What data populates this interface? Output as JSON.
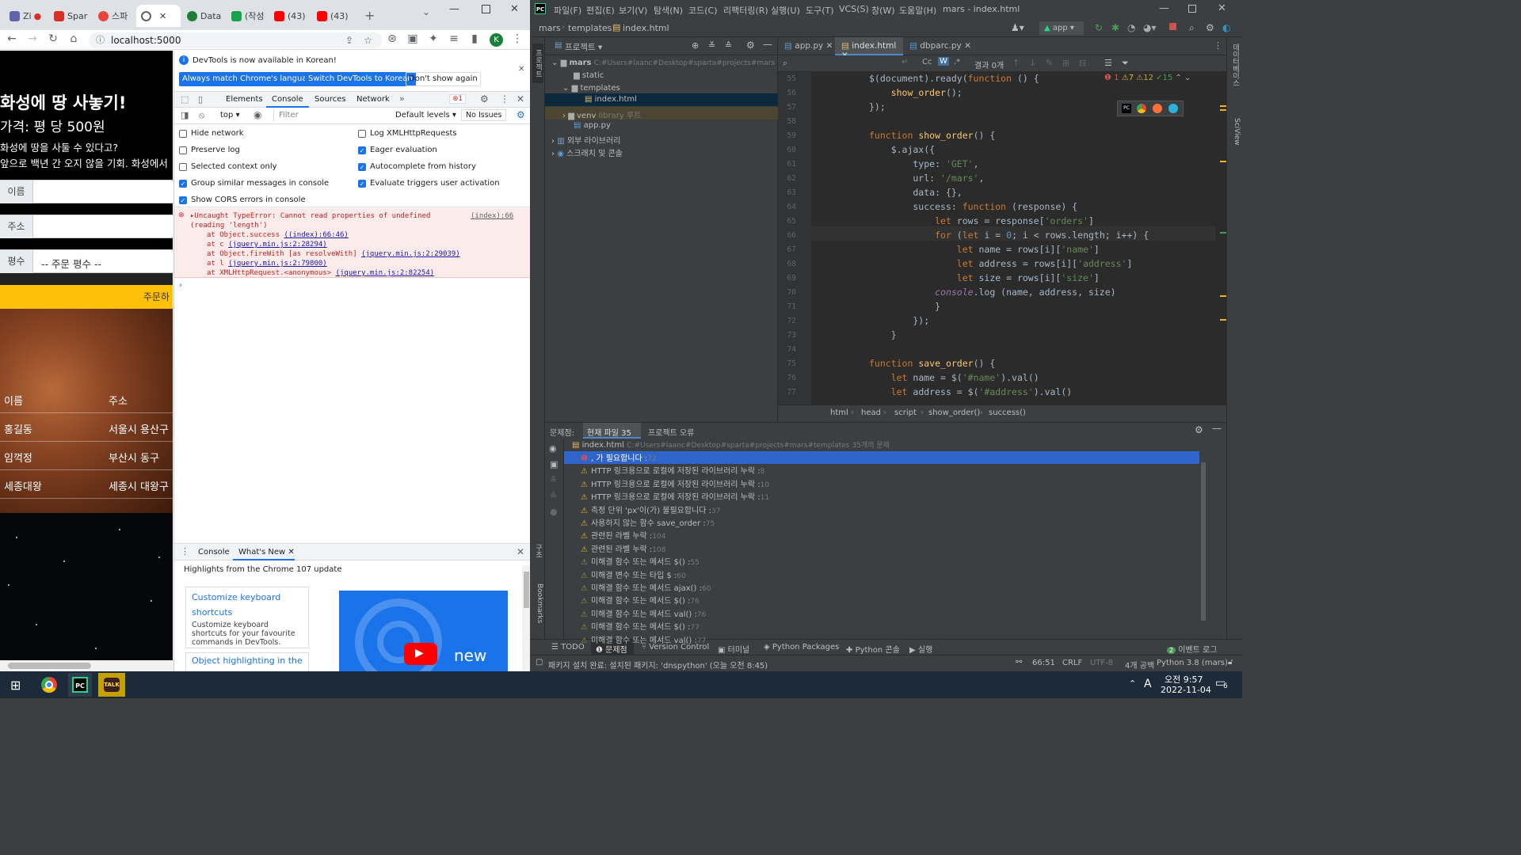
{
  "chrome": {
    "tabs": [
      {
        "label": "Zi",
        "color": "#6264a7"
      },
      {
        "label": "Spar",
        "color": "#d93025"
      },
      {
        "label": "스파",
        "color": "#e8453c"
      },
      {
        "label": "",
        "color": "#5f6368"
      },
      {
        "label": "Data",
        "color": "#1e7e34"
      },
      {
        "label": "(작성",
        "color": "#17a34a"
      },
      {
        "label": "(43)",
        "color": "#ff0000"
      },
      {
        "label": "(43)",
        "color": "#ff0000"
      }
    ],
    "url": "localhost:5000",
    "profile_initial": "K"
  },
  "page": {
    "title": "화성에 땅 사놓기!",
    "price": "가격: 평 당 500원",
    "desc1": "화성에 땅을 사둘 수 있다고?",
    "desc2": "앞으로 백년 간 오지 않을 기회. 화성에서",
    "name_label": "이름",
    "address_label": "주소",
    "size_label": "평수",
    "size_placeholder": "-- 주문 평수 --",
    "order_button": "주문하",
    "col_name": "이름",
    "col_address": "주소",
    "orders": [
      {
        "name": "홍길동",
        "address": "서울시 용산구"
      },
      {
        "name": "임꺽정",
        "address": "부산시 동구"
      },
      {
        "name": "세종대왕",
        "address": "세종시 대왕구"
      }
    ]
  },
  "devtools": {
    "notice": "DevTools is now available in Korean!",
    "btn_match": "Always match Chrome's language",
    "btn_switch": "Switch DevTools to Korean",
    "btn_dont": "Don't show again",
    "tabs": [
      "Elements",
      "Console",
      "Sources",
      "Network"
    ],
    "error_count": "1",
    "context": "top",
    "filter_placeholder": "Filter",
    "levels": "Default levels",
    "issues": "No Issues",
    "settings_left": [
      "Hide network",
      "Preserve log",
      "Selected context only",
      "Group similar messages in console",
      "Show CORS errors in console"
    ],
    "settings_left_checked": [
      false,
      false,
      false,
      true,
      true
    ],
    "settings_right": [
      "Log XMLHttpRequests",
      "Eager evaluation",
      "Autocomplete from history",
      "Evaluate triggers user activation"
    ],
    "settings_right_checked": [
      false,
      true,
      true,
      true
    ],
    "error_main": "Uncaught TypeError: Cannot read properties of undefined",
    "error_src": "(index):66",
    "error_reading": "(reading 'length')",
    "stack": [
      {
        "text": "at Object.success ",
        "link": "((index):66:46)"
      },
      {
        "text": "at c ",
        "link": "(jquery.min.js:2:28294)"
      },
      {
        "text": "at Object.fireWith [as resolveWith] ",
        "link": "(jquery.min.js:2:29039)"
      },
      {
        "text": "at l ",
        "link": "(jquery.min.js:2:79800)"
      },
      {
        "text": "at XMLHttpRequest.<anonymous> ",
        "link": "(jquery.min.js:2:82254)"
      }
    ],
    "drawer_tabs": [
      "Console",
      "What's New"
    ],
    "highlights": "Highlights from the Chrome 107 update",
    "card1_title": "Customize keyboard shortcuts",
    "card1_desc": "Customize keyboard shortcuts for your favourite commands in DevTools.",
    "card2_title": "Object highlighting in the",
    "video_text": "new"
  },
  "pycharm": {
    "menu": [
      "파일(F)",
      "편집(E)",
      "보기(V)",
      "탐색(N)",
      "코드(C)",
      "리팩터링(R)",
      "실행(U)",
      "도구(T)",
      "VCS(S)",
      "창(W)",
      "도움말(H)"
    ],
    "window_title": "mars - index.html",
    "breadcrumb": [
      "mars",
      "templates",
      "index.html"
    ],
    "run_config": "app",
    "project_label": "프로젝트",
    "editor_tabs": [
      "app.py",
      "index.html",
      "dbparc.py"
    ],
    "find_result": "결과 0개",
    "tree": {
      "root": "mars",
      "root_path": "C:#Users#laanc#Desktop#sparta#projects#mars",
      "static": "static",
      "templates": "templates",
      "index": "index.html",
      "venv": "venv",
      "venv_tag": "library 루트",
      "app": "app.py",
      "ext": "외부 라이브러리",
      "scratch": "스크래치 및 콘솔"
    },
    "inspections": {
      "errors": "1",
      "warn1": "7",
      "warn2": "12",
      "ok": "15"
    },
    "gutter_start": 55,
    "code_lines": [
      "$(document).ready(function () {",
      "    show_order();",
      "});",
      "",
      "function show_order() {",
      "    $.ajax({",
      "        type: 'GET',",
      "        url: '/mars',",
      "        data: {},",
      "        success: function (response) {",
      "            let rows = response['orders']",
      "            for (let i = 0; i < rows.length; i++) {",
      "                let name = rows[i]['name']",
      "                let address = rows[i]['address']",
      "                let size = rows[i]['size']",
      "            console.log (name, address, size)",
      "            }",
      "        });",
      "    }",
      "",
      "function save_order() {",
      "    let name = $('#name').val()",
      "    let address = $('#address').val()"
    ],
    "code_crumbs": [
      "html",
      "head",
      "script",
      "show_order()",
      "success()"
    ],
    "problems_tabs": [
      "문제점:",
      "현재 파일 35",
      "프로젝트 오류"
    ],
    "problems_file": "index.html",
    "problems_path": "C:#Users#laanc#Desktop#sparta#projects#mars#templates",
    "problems_count": "35개의 문제",
    "problems": [
      {
        "text": ", 가 필요합니다",
        "line": "72",
        "type": "error"
      },
      {
        "text": "HTTP 링크용으로 로컬에 저장된 라이브러리 누락",
        "line": "8",
        "type": "warn"
      },
      {
        "text": "HTTP 링크용으로 로컬에 저장된 라이브러리 누락",
        "line": "10",
        "type": "warn"
      },
      {
        "text": "HTTP 링크용으로 로컬에 저장된 라이브러리 누락",
        "line": "11",
        "type": "warn"
      },
      {
        "text": "측정 단위 'px'이(가) 불필요합니다",
        "line": "37",
        "type": "warn"
      },
      {
        "text": "사용하지 않는 함수 save_order",
        "line": "75",
        "type": "warn"
      },
      {
        "text": "관련된 라벨 누락",
        "line": "104",
        "type": "warn"
      },
      {
        "text": "관련된 라벨 누락",
        "line": "108",
        "type": "warn"
      },
      {
        "text": "미해결 함수 또는 메서드 $()",
        "line": "55",
        "type": "weak"
      },
      {
        "text": "미해결 변수 또는 타입 $",
        "line": "60",
        "type": "weak"
      },
      {
        "text": "미해결 함수 또는 메서드 ajax()",
        "line": "60",
        "type": "weak"
      },
      {
        "text": "미해결 함수 또는 메서드 $()",
        "line": "76",
        "type": "weak"
      },
      {
        "text": "미해결 함수 또는 메서드 val()",
        "line": "76",
        "type": "weak"
      },
      {
        "text": "미해결 함수 또는 메서드 $()",
        "line": "77",
        "type": "weak"
      },
      {
        "text": "미해결 함수 또는 메서드 val()",
        "line": "77",
        "type": "weak"
      }
    ],
    "bottom_tools": [
      "TODO",
      "문제점",
      "Version Control",
      "터미널",
      "Python Packages",
      "Python 콘솔",
      "실행"
    ],
    "event_log": "이벤트 로그",
    "event_count": "2",
    "side_left": [
      "프로젝트",
      "구조",
      "Bookmarks"
    ],
    "side_right": [
      "데이터베이스",
      "SciView"
    ],
    "status_msg": "패키지 설치 완료: 설치된 패키지: 'dnspython' (오늘 오전 8:45)",
    "status_pos": "66:51",
    "status_eol": "CRLF",
    "status_enc": "UTF-8",
    "status_indent": "4개 공백",
    "status_interp": "Python 3.8 (mars)"
  },
  "taskbar": {
    "time": "오전 9:57",
    "date": "2022-11-04",
    "ime": "A",
    "notif": "6"
  }
}
